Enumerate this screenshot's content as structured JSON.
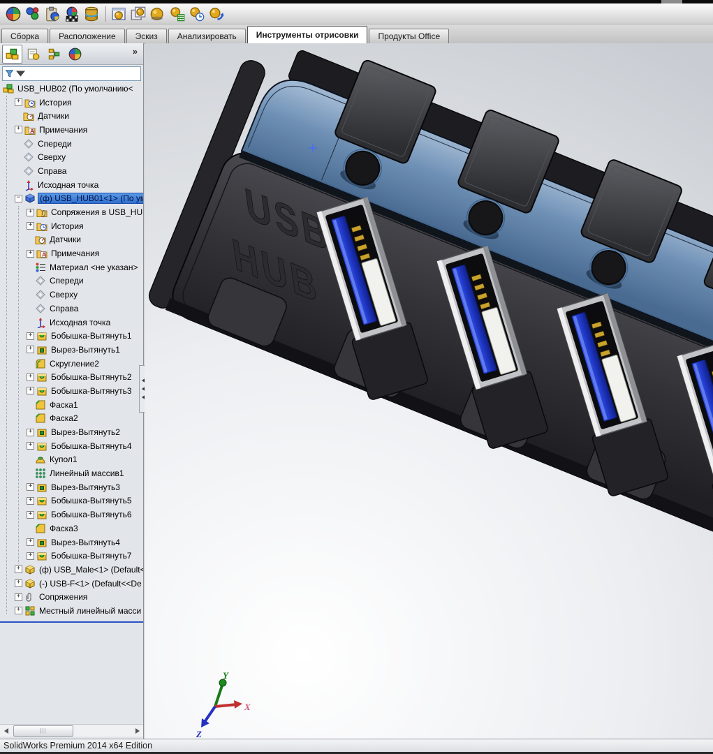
{
  "window": {
    "status_bar": "SolidWorks Premium 2014 x64 Edition"
  },
  "ribbon": {
    "tabs": [
      {
        "label": "Сборка",
        "active": false
      },
      {
        "label": "Расположение",
        "active": false
      },
      {
        "label": "Эскиз",
        "active": false
      },
      {
        "label": "Анализировать",
        "active": false
      },
      {
        "label": "Инструменты отрисовки",
        "active": true
      },
      {
        "label": "Продукты Office",
        "active": false
      }
    ]
  },
  "toolbar": {
    "icons": [
      "edit-appearance",
      "copy-appearance",
      "paste-appearance",
      "edit-scene",
      "appearance-library",
      "integrated-preview",
      "final-render",
      "render-region",
      "render-options",
      "schedule-render",
      "recall-render"
    ]
  },
  "headsup": {
    "icons": [
      "zoom-fit",
      "zoom-area",
      "rotate-view",
      "section-view",
      "view-orientation",
      "display-style"
    ]
  },
  "panel": {
    "tabs": [
      "featuremanager",
      "propertymanager",
      "configurationmanager",
      "displaymanager"
    ],
    "active_tab": 0,
    "overflow_chevron": "»",
    "tree": [
      {
        "label": "USB_HUB02 (По умолчанию<",
        "level": 0,
        "expand": "none",
        "icon": "assembly",
        "selected": false
      },
      {
        "label": "История",
        "level": 1,
        "expand": "plus",
        "icon": "history",
        "selected": false
      },
      {
        "label": "Датчики",
        "level": 1,
        "expand": "none",
        "icon": "sensors",
        "selected": false
      },
      {
        "label": "Примечания",
        "level": 1,
        "expand": "plus",
        "icon": "annotations",
        "selected": false
      },
      {
        "label": "Спереди",
        "level": 1,
        "expand": "none",
        "icon": "plane",
        "selected": false
      },
      {
        "label": "Сверху",
        "level": 1,
        "expand": "none",
        "icon": "plane",
        "selected": false
      },
      {
        "label": "Справа",
        "level": 1,
        "expand": "none",
        "icon": "plane",
        "selected": false
      },
      {
        "label": "Исходная точка",
        "level": 1,
        "expand": "none",
        "icon": "origin",
        "selected": false
      },
      {
        "label": "(ф) USB_HUB01<1> (По ум",
        "level": 1,
        "expand": "minus",
        "icon": "part-blue",
        "selected": true
      },
      {
        "label": "Сопряжения в USB_HU",
        "level": 2,
        "expand": "plus",
        "icon": "mates-folder",
        "selected": false
      },
      {
        "label": "История",
        "level": 2,
        "expand": "plus",
        "icon": "history",
        "selected": false
      },
      {
        "label": "Датчики",
        "level": 2,
        "expand": "none",
        "icon": "sensors",
        "selected": false
      },
      {
        "label": "Примечания",
        "level": 2,
        "expand": "plus",
        "icon": "annotations",
        "selected": false
      },
      {
        "label": "Материал <не указан>",
        "level": 2,
        "expand": "none",
        "icon": "material",
        "selected": false
      },
      {
        "label": "Спереди",
        "level": 2,
        "expand": "none",
        "icon": "plane",
        "selected": false
      },
      {
        "label": "Сверху",
        "level": 2,
        "expand": "none",
        "icon": "plane",
        "selected": false
      },
      {
        "label": "Справа",
        "level": 2,
        "expand": "none",
        "icon": "plane",
        "selected": false
      },
      {
        "label": "Исходная точка",
        "level": 2,
        "expand": "none",
        "icon": "origin",
        "selected": false
      },
      {
        "label": "Бобышка-Вытянуть1",
        "level": 2,
        "expand": "plus",
        "icon": "boss-extrude",
        "selected": false
      },
      {
        "label": "Вырез-Вытянуть1",
        "level": 2,
        "expand": "plus",
        "icon": "cut-extrude",
        "selected": false
      },
      {
        "label": "Скругление2",
        "level": 2,
        "expand": "none",
        "icon": "fillet",
        "selected": false
      },
      {
        "label": "Бобышка-Вытянуть2",
        "level": 2,
        "expand": "plus",
        "icon": "boss-extrude",
        "selected": false
      },
      {
        "label": "Бобышка-Вытянуть3",
        "level": 2,
        "expand": "plus",
        "icon": "boss-extrude",
        "selected": false
      },
      {
        "label": "Фаска1",
        "level": 2,
        "expand": "none",
        "icon": "chamfer",
        "selected": false
      },
      {
        "label": "Фаска2",
        "level": 2,
        "expand": "none",
        "icon": "chamfer",
        "selected": false
      },
      {
        "label": "Вырез-Вытянуть2",
        "level": 2,
        "expand": "plus",
        "icon": "cut-extrude",
        "selected": false
      },
      {
        "label": "Бобышка-Вытянуть4",
        "level": 2,
        "expand": "plus",
        "icon": "boss-extrude",
        "selected": false
      },
      {
        "label": "Купол1",
        "level": 2,
        "expand": "none",
        "icon": "dome",
        "selected": false
      },
      {
        "label": "Линейный массив1",
        "level": 2,
        "expand": "none",
        "icon": "linear-pattern",
        "selected": false
      },
      {
        "label": "Вырез-Вытянуть3",
        "level": 2,
        "expand": "plus",
        "icon": "cut-extrude",
        "selected": false
      },
      {
        "label": "Бобышка-Вытянуть5",
        "level": 2,
        "expand": "plus",
        "icon": "boss-extrude",
        "selected": false
      },
      {
        "label": "Бобышка-Вытянуть6",
        "level": 2,
        "expand": "plus",
        "icon": "boss-extrude",
        "selected": false
      },
      {
        "label": "Фаска3",
        "level": 2,
        "expand": "none",
        "icon": "chamfer",
        "selected": false
      },
      {
        "label": "Вырез-Вытянуть4",
        "level": 2,
        "expand": "plus",
        "icon": "cut-extrude",
        "selected": false
      },
      {
        "label": "Бобышка-Вытянуть7",
        "level": 2,
        "expand": "plus",
        "icon": "boss-extrude",
        "selected": false
      },
      {
        "label": "(ф) USB_Male<1> (Default<",
        "level": 1,
        "expand": "plus",
        "icon": "part-yellow",
        "selected": false
      },
      {
        "label": "(-) USB-F<1> (Default<<De",
        "level": 1,
        "expand": "plus",
        "icon": "part-yellow",
        "selected": false
      },
      {
        "label": "Сопряжения",
        "level": 1,
        "expand": "plus",
        "icon": "mates",
        "selected": false
      },
      {
        "label": "Местный линейный масси",
        "level": 1,
        "expand": "plus",
        "icon": "local-pattern",
        "selected": false
      }
    ]
  },
  "viewport": {
    "engraving_line1": "USB",
    "engraving_line2": "HUB",
    "axis_x": "X",
    "axis_y": "Y",
    "axis_z": "Z"
  },
  "colors": {
    "selection_blue": "#3d86e0",
    "band_blue": "#6d8fb5",
    "usb_tongue_blue": "#2a4be0",
    "accent_line_blue": "#2a52c8"
  }
}
